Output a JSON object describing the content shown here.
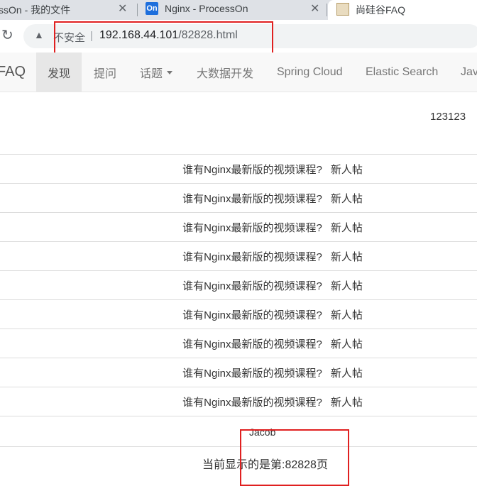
{
  "tabs": [
    {
      "title": "ssOn - 我的文件",
      "close": "✕"
    },
    {
      "favicon": "On",
      "title": "Nginx - ProcessOn",
      "close": "✕"
    },
    {
      "title": "尚硅谷FAQ"
    }
  ],
  "addressbar": {
    "reload_icon": "↻",
    "warning_icon": "▲",
    "security_label": "不安全",
    "separator": "|",
    "host": "192.168.44.101",
    "path": "/82828.html"
  },
  "nav": {
    "brand": "FAQ",
    "items": [
      "发现",
      "提问",
      "话题",
      "大数据开发",
      "Spring Cloud",
      "Elastic Search",
      "Java"
    ]
  },
  "user": "123123",
  "posts": [
    {
      "title": "谁有Nginx最新版的视频课程?",
      "badge": "新人帖"
    },
    {
      "title": "谁有Nginx最新版的视频课程?",
      "badge": "新人帖"
    },
    {
      "title": "谁有Nginx最新版的视频课程?",
      "badge": "新人帖"
    },
    {
      "title": "谁有Nginx最新版的视频课程?",
      "badge": "新人帖"
    },
    {
      "title": "谁有Nginx最新版的视频课程?",
      "badge": "新人帖"
    },
    {
      "title": "谁有Nginx最新版的视频课程?",
      "badge": "新人帖"
    },
    {
      "title": "谁有Nginx最新版的视频课程?",
      "badge": "新人帖"
    },
    {
      "title": "谁有Nginx最新版的视频课程?",
      "badge": "新人帖"
    },
    {
      "title": "谁有Nginx最新版的视频课程?",
      "badge": "新人帖"
    }
  ],
  "author": "Jacob",
  "page_info": "当前显示的是第:82828页",
  "colors": {
    "highlight": "#e02020",
    "navbar_bg": "#f8f8f8",
    "active_nav_bg": "#e7e7e7"
  }
}
